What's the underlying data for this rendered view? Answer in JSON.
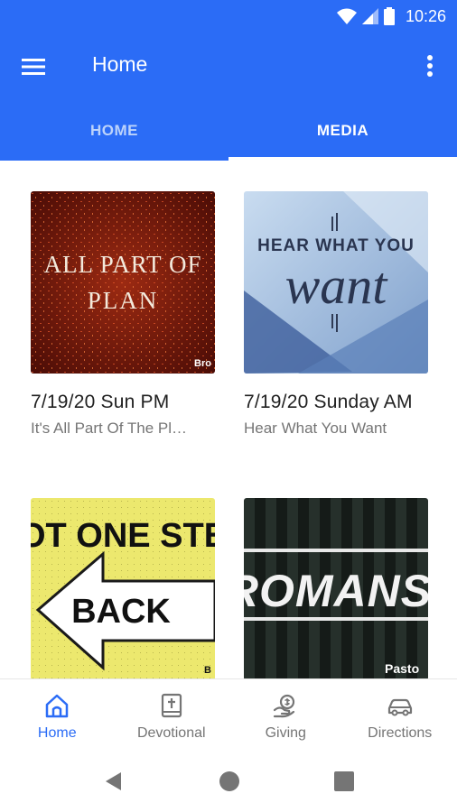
{
  "status": {
    "time": "10:26"
  },
  "app_bar": {
    "title": "Home"
  },
  "tabs": [
    {
      "label": "HOME",
      "selected": false
    },
    {
      "label": "MEDIA",
      "selected": true
    }
  ],
  "media": [
    {
      "title": "7/19/20 Sun PM",
      "subtitle": "It's All Part Of The Pl…",
      "art_text": [
        "ALL PART OF",
        "PLAN"
      ],
      "art_corner": "Bro"
    },
    {
      "title": "7/19/20 Sunday AM",
      "subtitle": "Hear What You Want",
      "art_text": [
        "HEAR WHAT YOU",
        "want"
      ]
    },
    {
      "art_text": [
        "OT ONE STE",
        "BACK"
      ],
      "art_corner": "B"
    },
    {
      "art_text": [
        "ROMANS"
      ],
      "art_corner": "Pasto"
    }
  ],
  "bottom_nav": [
    {
      "label": "Home",
      "icon": "home-icon",
      "active": true
    },
    {
      "label": "Devotional",
      "icon": "bible-icon",
      "active": false
    },
    {
      "label": "Giving",
      "icon": "giving-hand-icon",
      "active": false
    },
    {
      "label": "Directions",
      "icon": "car-icon",
      "active": false
    }
  ],
  "colors": {
    "primary": "#2b6cf6",
    "active_nav": "#2b6cf6",
    "inactive_text": "#757575"
  }
}
